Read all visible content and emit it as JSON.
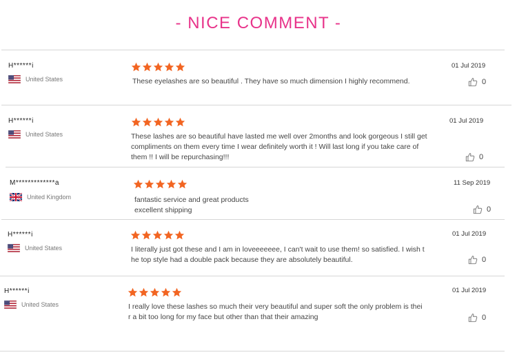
{
  "title": "- NICE COMMENT -",
  "colors": {
    "title": "#e8338a",
    "star": "#f26522",
    "divider": "#d6d6d6"
  },
  "reviews": [
    {
      "user": "H******i",
      "country": "United States",
      "flag": "us",
      "stars": 5,
      "date": "01 Jul 2019",
      "likes": "0",
      "text": "These eyelashes are so beautiful . They have so much dimension I highly recommend."
    },
    {
      "user": "H******i",
      "country": "United States",
      "flag": "us",
      "stars": 5,
      "date": "01 Jul 2019",
      "likes": "0",
      "text": "These lashes are so beautiful have lasted me well over 2months and look gorgeous I still get\ncompliments on them every time I wear definitely worth it ! Will last long if you take care of\nthem !! I will be repurchasing!!!"
    },
    {
      "user": "M*************a",
      "country": "United Kingdom",
      "flag": "uk",
      "stars": 5,
      "date": "11 Sep 2019",
      "likes": "0",
      "text": "fantastic service and great products\nexcellent shipping"
    },
    {
      "user": "H******i",
      "country": "United States",
      "flag": "us",
      "stars": 5,
      "date": "01 Jul 2019",
      "likes": "0",
      "text": "I literally just got these and I am in loveeeeeee, I can't wait to use them! so satisfied. I wish t\nhe top style had a double pack because they are absolutely beautiful."
    },
    {
      "user": "H******i",
      "country": "United States",
      "flag": "us",
      "stars": 5,
      "date": "01 Jul 2019",
      "likes": "0",
      "text": "I really love these lashes so much their very beautiful and super soft the only problem is thei\nr a bit too long for my face but other than that their amazing"
    }
  ]
}
